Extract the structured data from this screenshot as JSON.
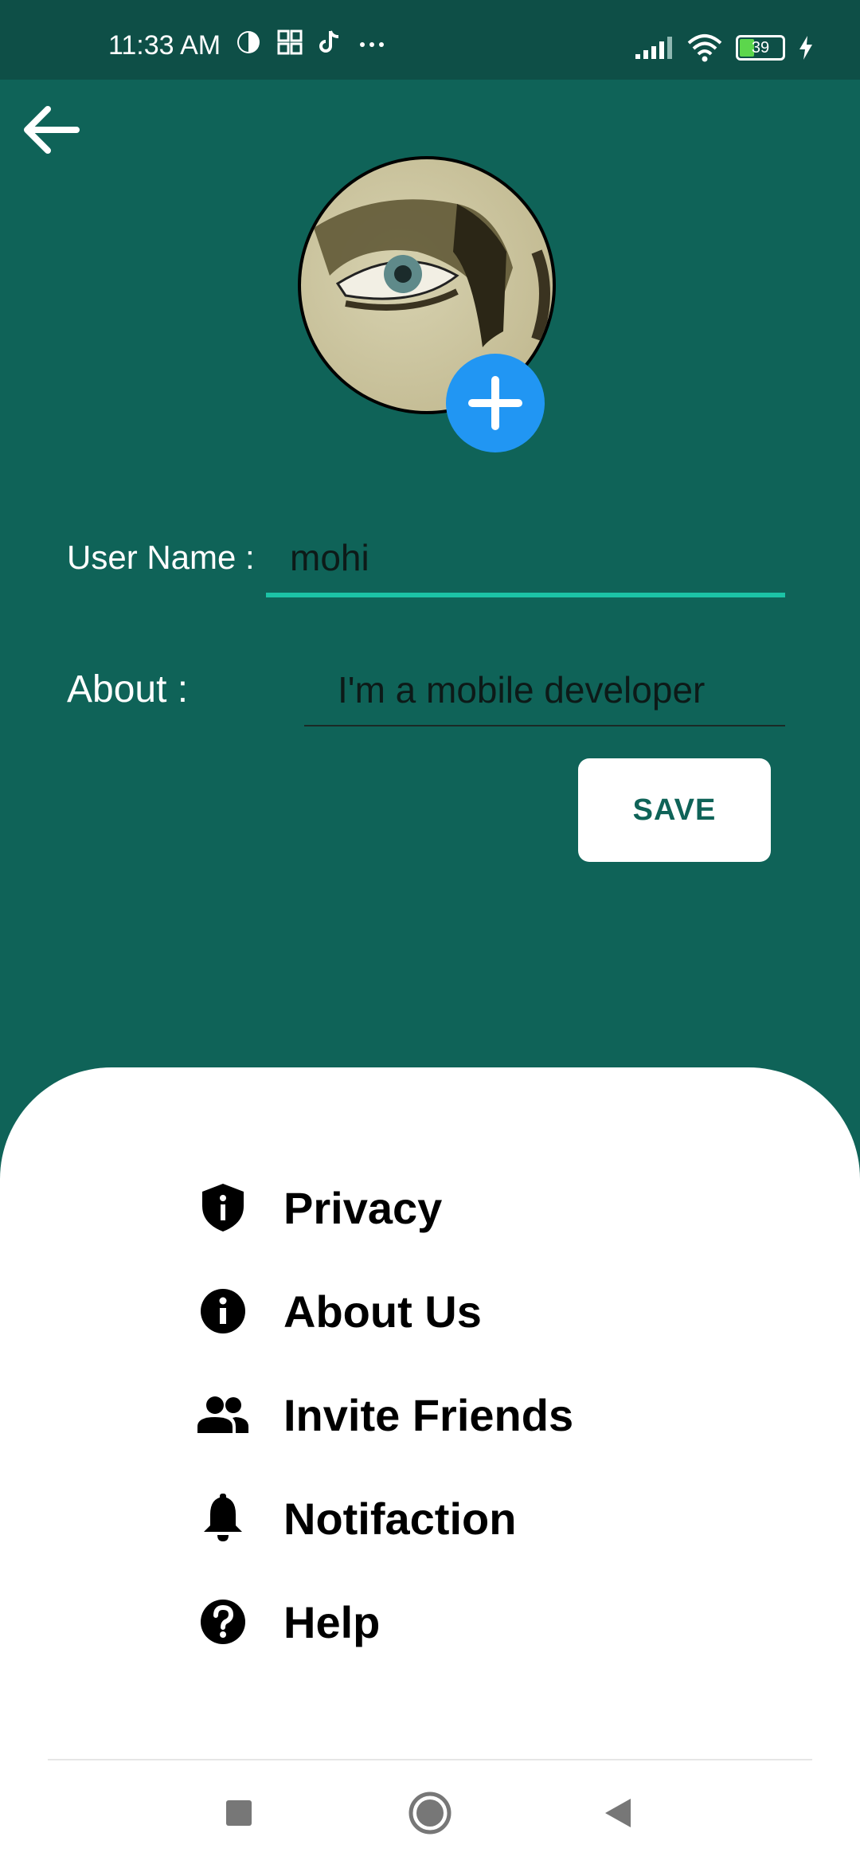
{
  "status_bar": {
    "time": "11:33 AM",
    "battery": "39",
    "icons": [
      "clock-app-icon",
      "apps-grid-icon",
      "tiktok-icon",
      "more-dots-icon",
      "signal-icon",
      "wifi-icon",
      "battery-icon",
      "charging-icon"
    ]
  },
  "header": {
    "back_icon": "arrow-left-icon"
  },
  "profile": {
    "add_photo_icon": "plus-icon",
    "username_label": "User Name :",
    "username_value": "mohi",
    "about_label": "About :",
    "about_value": "I'm a mobile developer",
    "save_label": "SAVE"
  },
  "menu": {
    "items": [
      {
        "label": "Privacy",
        "icon": "shield-icon"
      },
      {
        "label": "About Us",
        "icon": "info-icon"
      },
      {
        "label": "Invite Friends",
        "icon": "people-icon"
      },
      {
        "label": "Notifaction",
        "icon": "bell-icon"
      },
      {
        "label": "Help",
        "icon": "help-icon"
      }
    ]
  },
  "colors": {
    "primary": "#0f6358",
    "status_bar": "#0e4f47",
    "accent": "#1cc3a6",
    "fab": "#2196f3"
  },
  "nav_bar": {
    "buttons": [
      "recents-square-icon",
      "home-circle-icon",
      "back-triangle-icon"
    ]
  }
}
